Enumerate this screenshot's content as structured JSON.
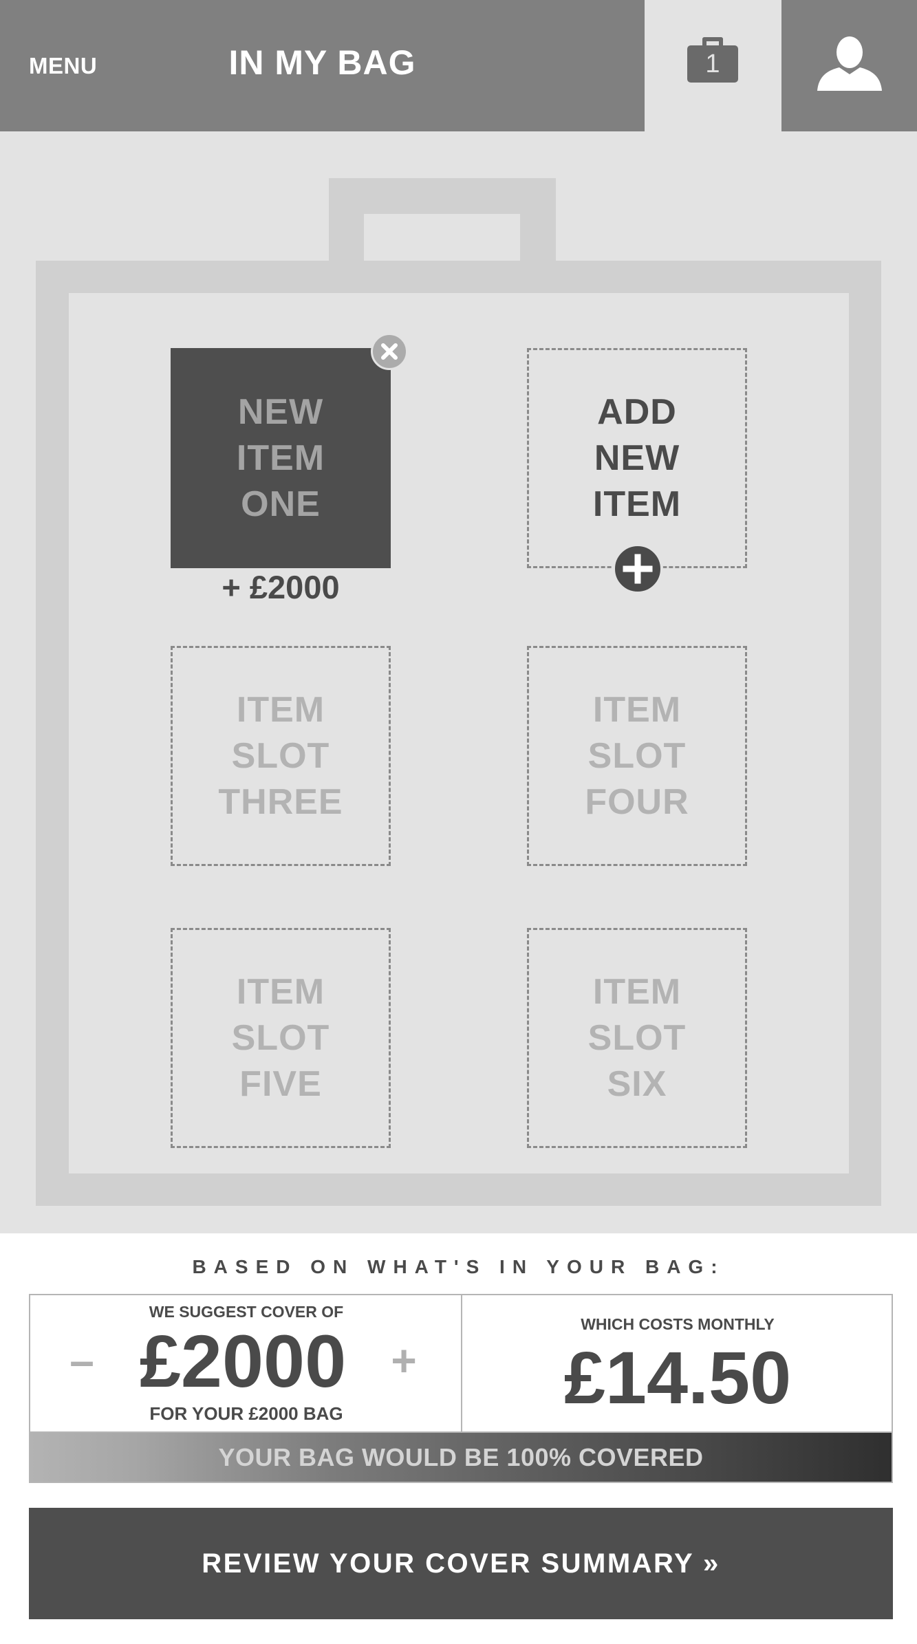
{
  "header": {
    "menu_label": "MENU",
    "title": "IN MY BAG",
    "bag_count": "1",
    "bag_icon": "bag-icon",
    "user_icon": "user-icon"
  },
  "bag": {
    "item_one": {
      "lines": [
        "NEW",
        "ITEM",
        "ONE"
      ],
      "price": "+ £2000"
    },
    "add_item": {
      "lines": [
        "ADD",
        "NEW",
        "ITEM"
      ]
    },
    "slot_three": {
      "lines": [
        "ITEM",
        "SLOT",
        "THREE"
      ]
    },
    "slot_four": {
      "lines": [
        "ITEM",
        "SLOT",
        "FOUR"
      ]
    },
    "slot_five": {
      "lines": [
        "ITEM",
        "SLOT",
        "FIVE"
      ]
    },
    "slot_six": {
      "lines": [
        "ITEM",
        "SLOT",
        "SIX"
      ]
    }
  },
  "summary": {
    "heading": "BASED ON WHAT'S IN YOUR BAG:",
    "suggest_label": "WE SUGGEST COVER OF",
    "minus": "–",
    "plus": "+",
    "cover_amount": "£2000",
    "for_bag": "FOR YOUR £2000 BAG",
    "costs_label": "WHICH COSTS MONTHLY",
    "monthly_cost": "£14.50",
    "coverage_text": "YOUR BAG WOULD BE 100% COVERED",
    "coverage_percent": 100
  },
  "review_button": "REVIEW YOUR COVER SUMMARY »",
  "colors": {
    "header": "#808080",
    "bag_tab": "#e3e3e3",
    "bag_frame": "#d0d0d0",
    "dark": "#4e4e4e"
  }
}
